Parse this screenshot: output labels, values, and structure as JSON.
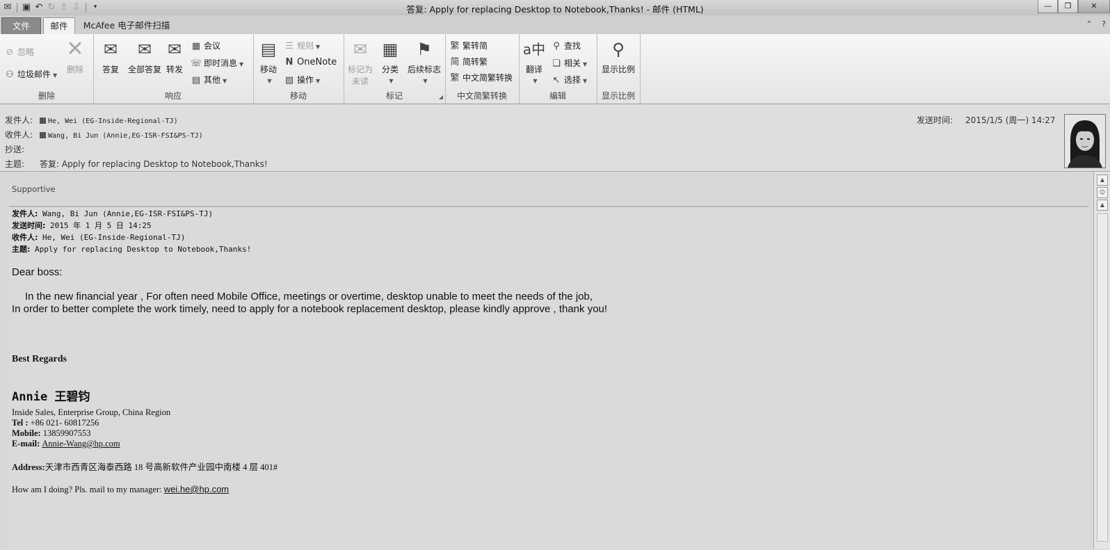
{
  "window": {
    "title": "答复: Apply for replacing Desktop to Notebook,Thanks!  - 邮件 (HTML)"
  },
  "tabs": [
    {
      "label": "文件"
    },
    {
      "label": "邮件"
    },
    {
      "label": "McAfee 电子邮件扫描"
    }
  ],
  "ribbon": {
    "delete_group": {
      "name": "删除",
      "ignore": "忽略",
      "junk": "垃圾邮件",
      "delete": "删除"
    },
    "respond_group": {
      "name": "响应",
      "reply": "答复",
      "reply_all": "全部答复",
      "forward": "转发",
      "meeting": "会议",
      "im": "即时消息",
      "more": "其他"
    },
    "move_group": {
      "name": "移动",
      "move": "移动",
      "rules": "规则",
      "onenote": "OneNote",
      "actions": "操作"
    },
    "tags_group": {
      "name": "标记",
      "mark_unread_1": "标记为",
      "mark_unread_2": "未读",
      "categorize": "分类",
      "followup": "后续标志"
    },
    "chinese_group": {
      "name": "中文简繁转换",
      "to_simplified": "繁转简",
      "to_traditional": "简转繁",
      "convert": "中文简繁转换"
    },
    "edit_group": {
      "name": "编辑",
      "translate": "翻译",
      "find": "查找",
      "related": "相关",
      "select": "选择"
    },
    "zoom_group": {
      "name": "显示比例",
      "zoom": "显示比例"
    }
  },
  "header": {
    "from_label": "发件人:",
    "from_value": "He, Wei (EG-Inside-Regional-TJ)",
    "to_label": "收件人:",
    "to_value": "Wang, Bi Jun (Annie,EG-ISR-FSI&PS-TJ)",
    "cc_label": "抄送:",
    "subject_label": "主题:",
    "subject_value": "答复: Apply for replacing Desktop to Notebook,Thanks!",
    "sent_label": "发送时间:",
    "sent_value": "2015/1/5 (周一) 14:27"
  },
  "body": {
    "reply_text": "Supportive",
    "quote": {
      "from_label": "发件人:",
      "from_value": " Wang, Bi Jun (Annie,EG-ISR-FSI&PS-TJ)",
      "sent_label": "发送时间:",
      "sent_value": " 2015 年 1 月 5 日 14:25",
      "to_label": "收件人:",
      "to_value": " He, Wei (EG-Inside-Regional-TJ)",
      "subject_label": "主题:",
      "subject_value": " Apply for replacing Desktop to Notebook,Thanks!"
    },
    "greeting": "Dear  boss:",
    "para1": "In the new financial year , For often need  Mobile Office, meetings or overtime, desktop unable to meet the needs of the job,",
    "para2": "In order to better complete the work timely, need to apply for a notebook replacement desktop, please kindly approve , thank you!",
    "regards": "Best Regards",
    "sig_name": "Annie 王碧钧",
    "sig_dept": "Inside Sales,  Enterprise Group, China Region",
    "tel_label": "Tel : ",
    "tel_value": "+86 021- 60817256",
    "mobile_label": "Mobile: ",
    "mobile_value": "13859907553",
    "email_label": "E-mail: ",
    "email_value": "Annie-Wang@hp.com",
    "address_label": "Address:",
    "address_value": "天津市西青区海泰西路 18 号高新软件产业园中南楼 4 层 401#",
    "feedback_text": "How am I doing? Pls. mail to my manager: ",
    "feedback_link": "wei.he@hp.com"
  }
}
